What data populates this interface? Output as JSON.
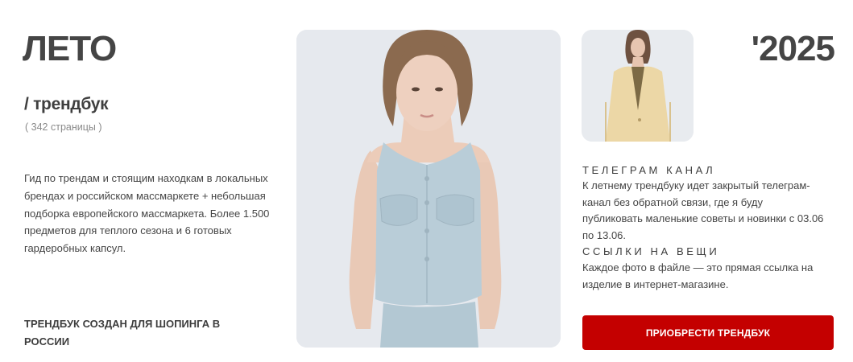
{
  "hero": {
    "season": "ЛЕТО",
    "year": "'2025",
    "subtitle": "/ трендбук",
    "pages": "( 342 страницы )"
  },
  "description": "Гид по трендам и стоящим находкам в локальных брендах и российском массмаркете + небольшая подборка европейского массмаркета. Более 1.500 предметов для теплого сезона и 6 готовых гардеробных капсул.",
  "footnote": "ТРЕНДБУК СОЗДАН ДЛЯ ШОПИНГА В РОССИИ",
  "sections": [
    {
      "title": "ТЕЛЕГРАМ КАНАЛ",
      "body": "К летнему трендбуку идет закрытый телеграм-канал без обратной связи, где я буду публиковать маленькие советы и новинки с 03.06 по 13.06."
    },
    {
      "title": "ССЫЛКИ НА ВЕЩИ",
      "body": "Каждое фото в файле — это прямая ссылка на изделие в интернет-магазине."
    }
  ],
  "cta": {
    "label": "ПРИОБРЕСТИ ТРЕНДБУК",
    "color": "#c40000"
  },
  "colors": {
    "vest": "#b9cdd8",
    "coat": "#ecd7a6",
    "photo_bg": "#e6e9ee"
  }
}
